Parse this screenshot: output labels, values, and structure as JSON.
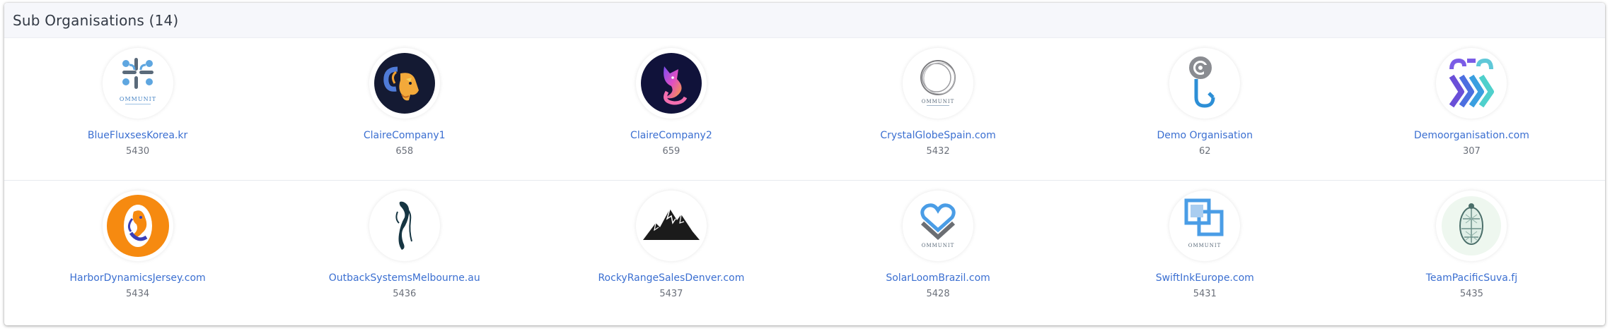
{
  "header": {
    "title": "Sub Organisations (14)"
  },
  "colors": {
    "link": "#3b6fd1",
    "count": "#6b707a",
    "header_bg": "#f6f7fb"
  },
  "orgs": [
    {
      "name": "BlueFluxsesKorea.kr",
      "count": "5430",
      "logo": "blue-cross-community-logo",
      "logo_text": "OMMUNIT"
    },
    {
      "name": "ClaireCompany1",
      "count": "658",
      "logo": "ram-logo"
    },
    {
      "name": "ClaireCompany2",
      "count": "659",
      "logo": "fox-logo"
    },
    {
      "name": "CrystalGlobeSpain.com",
      "count": "5432",
      "logo": "ring-community-logo",
      "logo_text": "OMMUNIT"
    },
    {
      "name": "Demo Organisation",
      "count": "62",
      "logo": "at-hook-logo"
    },
    {
      "name": "Demoorganisation.com",
      "count": "307",
      "logo": "chain-links-logo"
    },
    {
      "name": "HarborDynamicsJersey.com",
      "count": "5434",
      "logo": "orange-phoenix-logo"
    },
    {
      "name": "OutbackSystemsMelbourne.au",
      "count": "5436",
      "logo": "horse-logo"
    },
    {
      "name": "RockyRangeSalesDenver.com",
      "count": "5437",
      "logo": "mountains-logo"
    },
    {
      "name": "SolarLoomBrazil.com",
      "count": "5428",
      "logo": "heart-community-logo",
      "logo_text": "OMMUNIT"
    },
    {
      "name": "SwiftInkEurope.com",
      "count": "5431",
      "logo": "squares-community-logo",
      "logo_text": "OMMUNIT"
    },
    {
      "name": "TeamPacificSuva.fj",
      "count": "5435",
      "logo": "turtle-logo"
    }
  ]
}
